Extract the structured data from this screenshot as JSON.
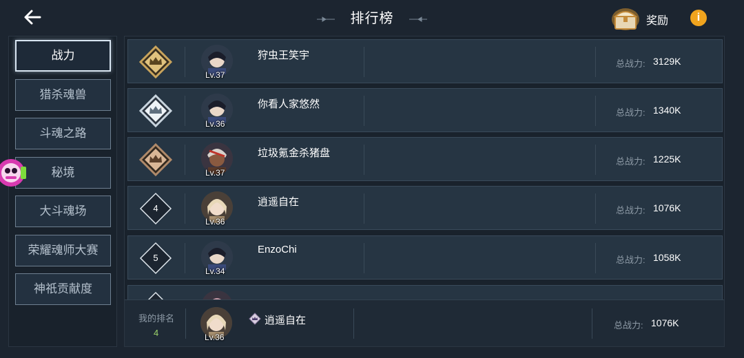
{
  "header": {
    "title": "排行榜",
    "reward_label": "奖励",
    "info_label": "i"
  },
  "sidebar": {
    "items": [
      {
        "label": "战力",
        "active": true
      },
      {
        "label": "猎杀魂兽",
        "active": false
      },
      {
        "label": "斗魂之路",
        "active": false
      },
      {
        "label": "秘境",
        "active": false
      },
      {
        "label": "大斗魂场",
        "active": false
      },
      {
        "label": "荣耀魂师大赛",
        "active": false
      },
      {
        "label": "神祇贡献度",
        "active": false
      }
    ]
  },
  "ranking": {
    "power_label": "总战力:",
    "rows": [
      {
        "rank": "1",
        "badge": "gold-crown",
        "name": "狩虫王笑宇",
        "level": "Lv.37",
        "power": "3129K"
      },
      {
        "rank": "2",
        "badge": "silver-crown",
        "name": "你看人家悠然",
        "level": "Lv.36",
        "power": "1340K"
      },
      {
        "rank": "3",
        "badge": "bronze-crown",
        "name": "垃圾氪金杀猪盘",
        "level": "Lv.37",
        "power": "1225K"
      },
      {
        "rank": "4",
        "badge": "number",
        "name": "逍遥自在",
        "level": "Lv.36",
        "power": "1076K"
      },
      {
        "rank": "5",
        "badge": "number",
        "name": "EnzoChi",
        "level": "Lv.34",
        "power": "1058K"
      }
    ]
  },
  "my_rank": {
    "label": "我的排名",
    "rank": "4",
    "name": "逍遥自在",
    "level": "Lv.36",
    "power": "1076K"
  },
  "colors": {
    "background": "#1c2530",
    "row_bg": "#263543",
    "gold": "#c9a45c",
    "silver": "#c8d4de",
    "bronze": "#b08a6a",
    "my_rank_green": "#9bd36b",
    "info_orange": "#f0a41e"
  }
}
